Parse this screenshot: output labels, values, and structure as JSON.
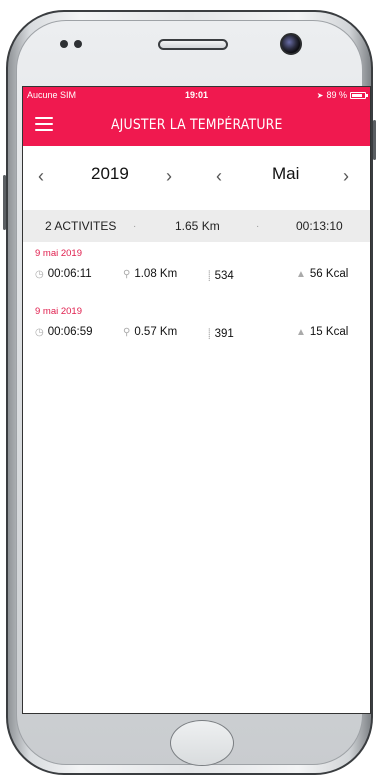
{
  "status_bar": {
    "carrier": "Aucune SIM",
    "time": "19:01",
    "battery": "89 %"
  },
  "header": {
    "title": "AJUSTER LA TEMPÉRATURE"
  },
  "year_selector": {
    "value": "2019"
  },
  "month_selector": {
    "value": "Mai"
  },
  "summary": {
    "activities": "2 ACTIVITES",
    "distance": "1.65 Km",
    "duration": "00:13:10"
  },
  "activities": [
    {
      "date": "9 mai 2019",
      "duration": "00:06:11",
      "distance": "1.08 Km",
      "steps": "534",
      "calories": "56 Kcal"
    },
    {
      "date": "9 mai 2019",
      "duration": "00:06:59",
      "distance": "0.57 Km",
      "steps": "391",
      "calories": "15 Kcal"
    }
  ],
  "colors": {
    "accent": "#f0194f",
    "date_text": "#e0204f",
    "summary_bg": "#ececec"
  },
  "icons": {
    "menu": "hamburger-menu-icon",
    "prev": "chevron-left-icon",
    "next": "chevron-right-icon",
    "duration": "clock-icon",
    "distance": "location-pin-icon",
    "steps": "footsteps-icon",
    "calories": "flame-icon"
  }
}
